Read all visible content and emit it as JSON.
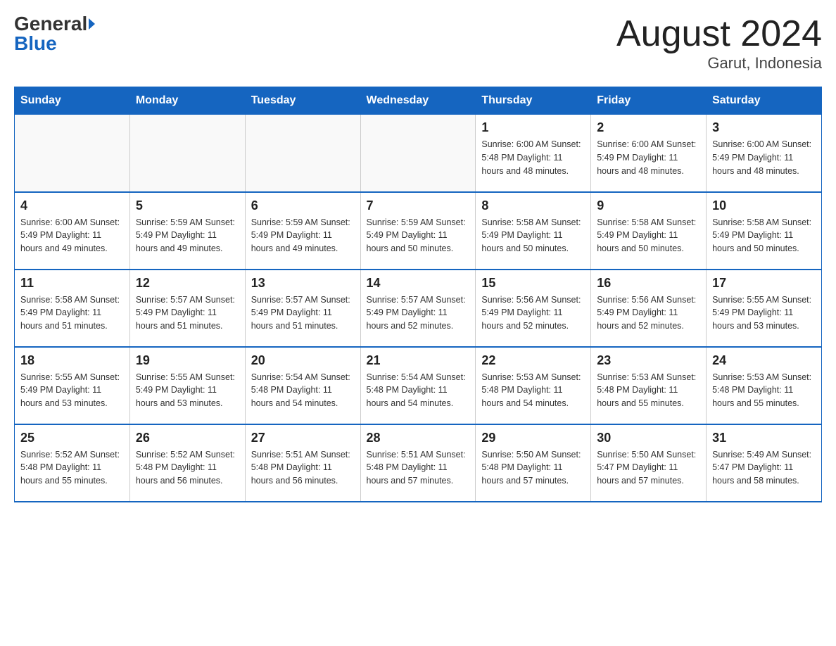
{
  "logo": {
    "general": "General",
    "blue": "Blue"
  },
  "title": "August 2024",
  "subtitle": "Garut, Indonesia",
  "days_of_week": [
    "Sunday",
    "Monday",
    "Tuesday",
    "Wednesday",
    "Thursday",
    "Friday",
    "Saturday"
  ],
  "weeks": [
    [
      {
        "day": "",
        "info": ""
      },
      {
        "day": "",
        "info": ""
      },
      {
        "day": "",
        "info": ""
      },
      {
        "day": "",
        "info": ""
      },
      {
        "day": "1",
        "info": "Sunrise: 6:00 AM\nSunset: 5:48 PM\nDaylight: 11 hours\nand 48 minutes."
      },
      {
        "day": "2",
        "info": "Sunrise: 6:00 AM\nSunset: 5:49 PM\nDaylight: 11 hours\nand 48 minutes."
      },
      {
        "day": "3",
        "info": "Sunrise: 6:00 AM\nSunset: 5:49 PM\nDaylight: 11 hours\nand 48 minutes."
      }
    ],
    [
      {
        "day": "4",
        "info": "Sunrise: 6:00 AM\nSunset: 5:49 PM\nDaylight: 11 hours\nand 49 minutes."
      },
      {
        "day": "5",
        "info": "Sunrise: 5:59 AM\nSunset: 5:49 PM\nDaylight: 11 hours\nand 49 minutes."
      },
      {
        "day": "6",
        "info": "Sunrise: 5:59 AM\nSunset: 5:49 PM\nDaylight: 11 hours\nand 49 minutes."
      },
      {
        "day": "7",
        "info": "Sunrise: 5:59 AM\nSunset: 5:49 PM\nDaylight: 11 hours\nand 50 minutes."
      },
      {
        "day": "8",
        "info": "Sunrise: 5:58 AM\nSunset: 5:49 PM\nDaylight: 11 hours\nand 50 minutes."
      },
      {
        "day": "9",
        "info": "Sunrise: 5:58 AM\nSunset: 5:49 PM\nDaylight: 11 hours\nand 50 minutes."
      },
      {
        "day": "10",
        "info": "Sunrise: 5:58 AM\nSunset: 5:49 PM\nDaylight: 11 hours\nand 50 minutes."
      }
    ],
    [
      {
        "day": "11",
        "info": "Sunrise: 5:58 AM\nSunset: 5:49 PM\nDaylight: 11 hours\nand 51 minutes."
      },
      {
        "day": "12",
        "info": "Sunrise: 5:57 AM\nSunset: 5:49 PM\nDaylight: 11 hours\nand 51 minutes."
      },
      {
        "day": "13",
        "info": "Sunrise: 5:57 AM\nSunset: 5:49 PM\nDaylight: 11 hours\nand 51 minutes."
      },
      {
        "day": "14",
        "info": "Sunrise: 5:57 AM\nSunset: 5:49 PM\nDaylight: 11 hours\nand 52 minutes."
      },
      {
        "day": "15",
        "info": "Sunrise: 5:56 AM\nSunset: 5:49 PM\nDaylight: 11 hours\nand 52 minutes."
      },
      {
        "day": "16",
        "info": "Sunrise: 5:56 AM\nSunset: 5:49 PM\nDaylight: 11 hours\nand 52 minutes."
      },
      {
        "day": "17",
        "info": "Sunrise: 5:55 AM\nSunset: 5:49 PM\nDaylight: 11 hours\nand 53 minutes."
      }
    ],
    [
      {
        "day": "18",
        "info": "Sunrise: 5:55 AM\nSunset: 5:49 PM\nDaylight: 11 hours\nand 53 minutes."
      },
      {
        "day": "19",
        "info": "Sunrise: 5:55 AM\nSunset: 5:49 PM\nDaylight: 11 hours\nand 53 minutes."
      },
      {
        "day": "20",
        "info": "Sunrise: 5:54 AM\nSunset: 5:48 PM\nDaylight: 11 hours\nand 54 minutes."
      },
      {
        "day": "21",
        "info": "Sunrise: 5:54 AM\nSunset: 5:48 PM\nDaylight: 11 hours\nand 54 minutes."
      },
      {
        "day": "22",
        "info": "Sunrise: 5:53 AM\nSunset: 5:48 PM\nDaylight: 11 hours\nand 54 minutes."
      },
      {
        "day": "23",
        "info": "Sunrise: 5:53 AM\nSunset: 5:48 PM\nDaylight: 11 hours\nand 55 minutes."
      },
      {
        "day": "24",
        "info": "Sunrise: 5:53 AM\nSunset: 5:48 PM\nDaylight: 11 hours\nand 55 minutes."
      }
    ],
    [
      {
        "day": "25",
        "info": "Sunrise: 5:52 AM\nSunset: 5:48 PM\nDaylight: 11 hours\nand 55 minutes."
      },
      {
        "day": "26",
        "info": "Sunrise: 5:52 AM\nSunset: 5:48 PM\nDaylight: 11 hours\nand 56 minutes."
      },
      {
        "day": "27",
        "info": "Sunrise: 5:51 AM\nSunset: 5:48 PM\nDaylight: 11 hours\nand 56 minutes."
      },
      {
        "day": "28",
        "info": "Sunrise: 5:51 AM\nSunset: 5:48 PM\nDaylight: 11 hours\nand 57 minutes."
      },
      {
        "day": "29",
        "info": "Sunrise: 5:50 AM\nSunset: 5:48 PM\nDaylight: 11 hours\nand 57 minutes."
      },
      {
        "day": "30",
        "info": "Sunrise: 5:50 AM\nSunset: 5:47 PM\nDaylight: 11 hours\nand 57 minutes."
      },
      {
        "day": "31",
        "info": "Sunrise: 5:49 AM\nSunset: 5:47 PM\nDaylight: 11 hours\nand 58 minutes."
      }
    ]
  ]
}
